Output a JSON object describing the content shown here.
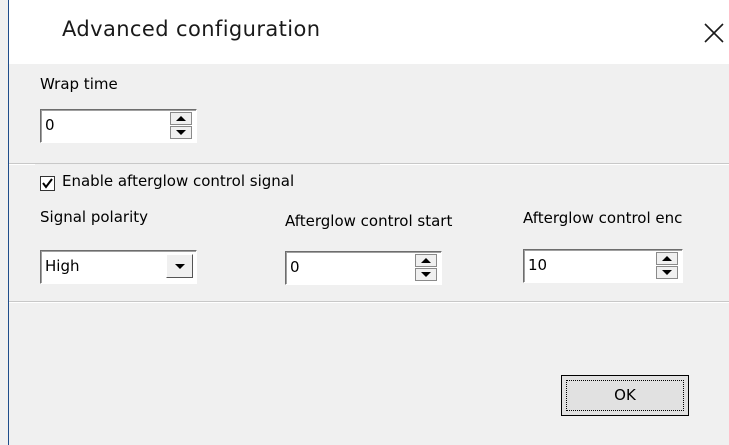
{
  "window": {
    "title": "Advanced configuration"
  },
  "wrap_time": {
    "label": "Wrap time",
    "value": "0"
  },
  "afterglow_group": {
    "checkbox_label": "Enable afterglow control signal",
    "checked": true,
    "signal_polarity": {
      "label": "Signal polarity",
      "selected": "High"
    },
    "control_start": {
      "label": "Afterglow control start",
      "value": "0"
    },
    "control_end": {
      "label": "Afterglow control enc",
      "value": "10"
    }
  },
  "buttons": {
    "ok_label": "OK"
  },
  "icons": {
    "close": "close-icon",
    "check": "checkmark-icon",
    "spin_up": "arrow-up-icon",
    "spin_down": "arrow-down-icon",
    "dropdown": "chevron-down-icon"
  }
}
